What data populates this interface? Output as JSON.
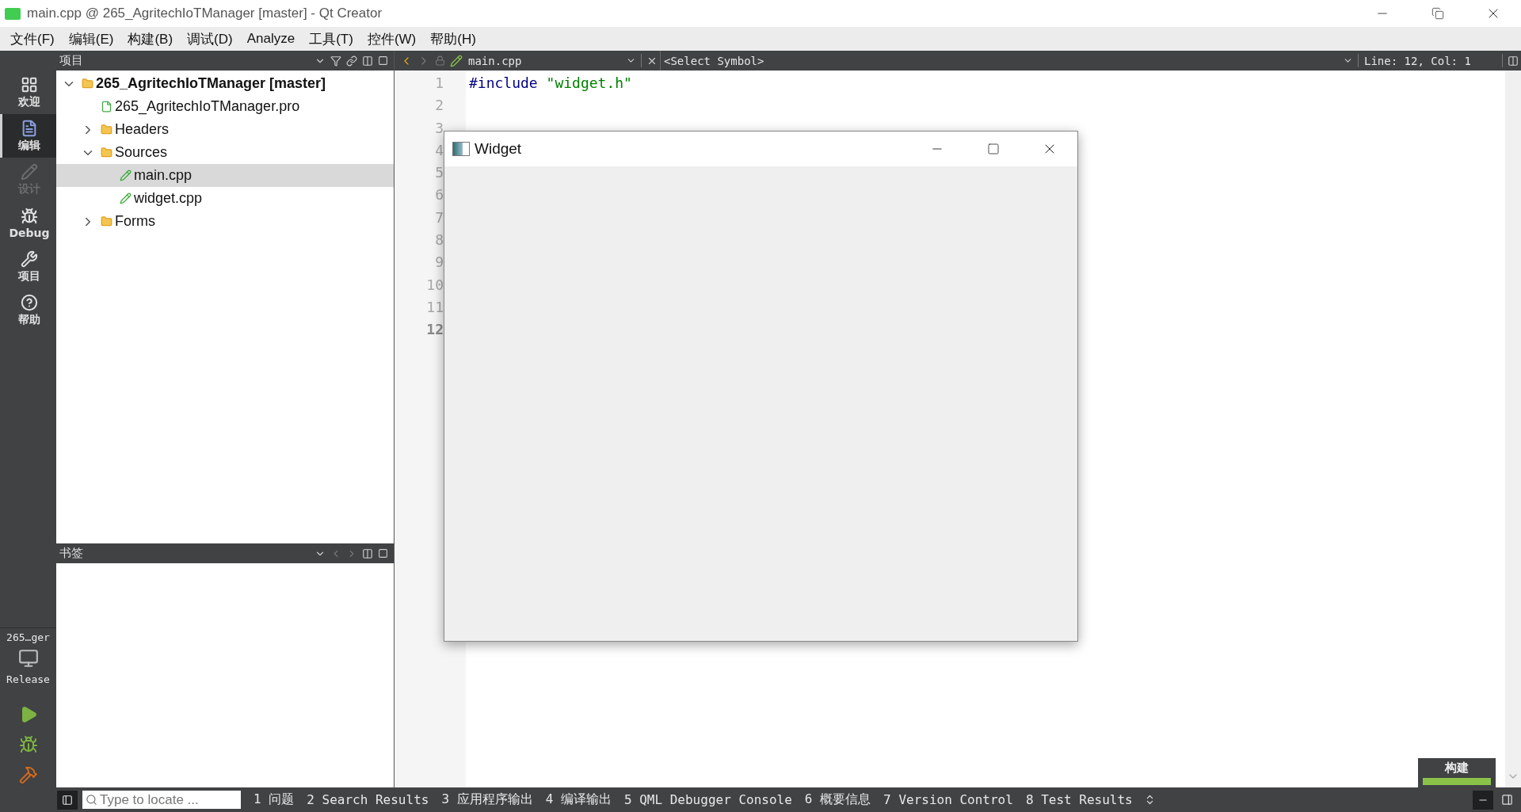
{
  "window": {
    "title": "main.cpp @ 265_AgritechIoTManager [master] - Qt Creator"
  },
  "menu": [
    "文件(F)",
    "编辑(E)",
    "构建(B)",
    "调试(D)",
    "Analyze",
    "工具(T)",
    "控件(W)",
    "帮助(H)"
  ],
  "modes": [
    {
      "label": "欢迎",
      "kind": "welcome",
      "selected": false,
      "disabled": false
    },
    {
      "label": "编辑",
      "kind": "edit",
      "selected": true,
      "disabled": false
    },
    {
      "label": "设计",
      "kind": "design",
      "selected": false,
      "disabled": true
    },
    {
      "label": "Debug",
      "kind": "debug",
      "selected": false,
      "disabled": false
    },
    {
      "label": "项目",
      "kind": "projects",
      "selected": false,
      "disabled": false
    },
    {
      "label": "帮助",
      "kind": "help",
      "selected": false,
      "disabled": false
    }
  ],
  "kit": {
    "project": "265…ger",
    "build": "Release"
  },
  "project_panel": {
    "title": "项目",
    "tree": [
      {
        "label": "265_AgritechIoTManager [master]",
        "kind": "project",
        "expanded": true,
        "selected": false,
        "children": [
          {
            "label": "265_AgritechIoTManager.pro",
            "kind": "pro",
            "selected": false
          },
          {
            "label": "Headers",
            "kind": "headers",
            "expanded": false,
            "selected": false
          },
          {
            "label": "Sources",
            "kind": "sources",
            "expanded": true,
            "selected": false,
            "children": [
              {
                "label": "main.cpp",
                "kind": "file",
                "selected": true
              },
              {
                "label": "widget.cpp",
                "kind": "file",
                "selected": false
              }
            ]
          },
          {
            "label": "Forms",
            "kind": "forms",
            "expanded": false,
            "selected": false
          }
        ]
      }
    ]
  },
  "bookmarks_panel": {
    "title": "书签"
  },
  "editor": {
    "file": "main.cpp",
    "symbol": "<Select Symbol>",
    "position": "Line: 12, Col: 1",
    "lines": [
      {
        "number": "1",
        "current": false,
        "tokens": [
          {
            "kind": "directive",
            "text": "#include"
          },
          {
            "kind": "string",
            "text": " \"widget.h\""
          }
        ]
      },
      {
        "number": "2",
        "current": false
      },
      {
        "number": "3",
        "current": false
      },
      {
        "number": "4",
        "current": false
      },
      {
        "number": "5",
        "current": false
      },
      {
        "number": "6",
        "current": false
      },
      {
        "number": "7",
        "current": false
      },
      {
        "number": "8",
        "current": false
      },
      {
        "number": "9",
        "current": false
      },
      {
        "number": "10",
        "current": false
      },
      {
        "number": "11",
        "current": false
      },
      {
        "number": "12",
        "current": true
      }
    ]
  },
  "widget_window": {
    "title": "Widget"
  },
  "build_progress": {
    "label": "构建",
    "level": 1
  },
  "locator": {
    "placeholder": "Type to locate ..."
  },
  "output_tabs": [
    {
      "number": "1",
      "label": "问题"
    },
    {
      "number": "2",
      "label": "Search Results"
    },
    {
      "number": "3",
      "label": "应用程序输出"
    },
    {
      "number": "4",
      "label": "编译输出"
    },
    {
      "number": "5",
      "label": "QML Debugger Console"
    },
    {
      "number": "6",
      "label": "概要信息"
    },
    {
      "number": "7",
      "label": "Version Control"
    },
    {
      "number": "8",
      "label": "Test Results"
    }
  ]
}
